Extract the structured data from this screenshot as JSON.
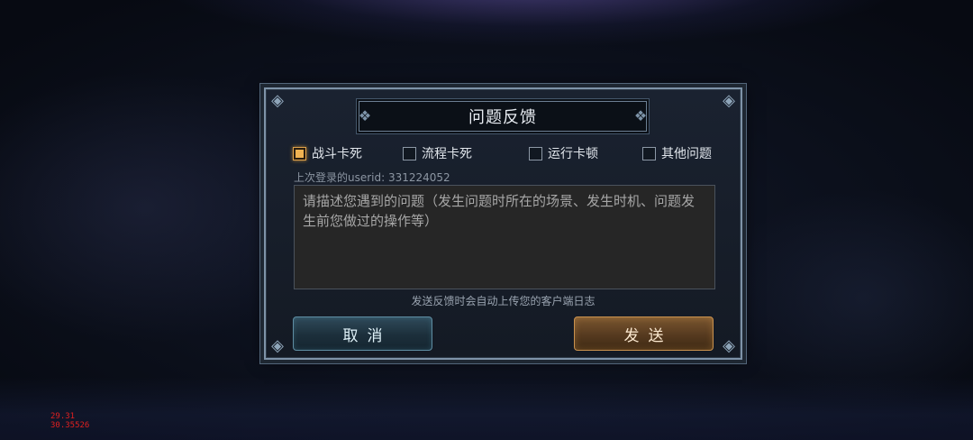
{
  "dialog": {
    "title": "问题反馈",
    "options": [
      {
        "label": "战斗卡死",
        "checked": true
      },
      {
        "label": "流程卡死",
        "checked": false
      },
      {
        "label": "运行卡顿",
        "checked": false
      },
      {
        "label": "其他问题",
        "checked": false
      }
    ],
    "userid_text": "上次登录的userid: 331224052",
    "textarea_placeholder": "请描述您遇到的问题（发生问题时所在的场景、发生时机、问题发生前您做过的操作等）",
    "notice": "发送反馈时会自动上传您的客户端日志",
    "cancel_label": "取消",
    "send_label": "发送"
  },
  "debug": {
    "line1": "29.31",
    "line2": "30.35526"
  },
  "colors": {
    "checked_accent": "#f0b352",
    "send_button": "#7a5630",
    "cancel_button": "#2f4a5a",
    "debug_text": "#e02020"
  }
}
